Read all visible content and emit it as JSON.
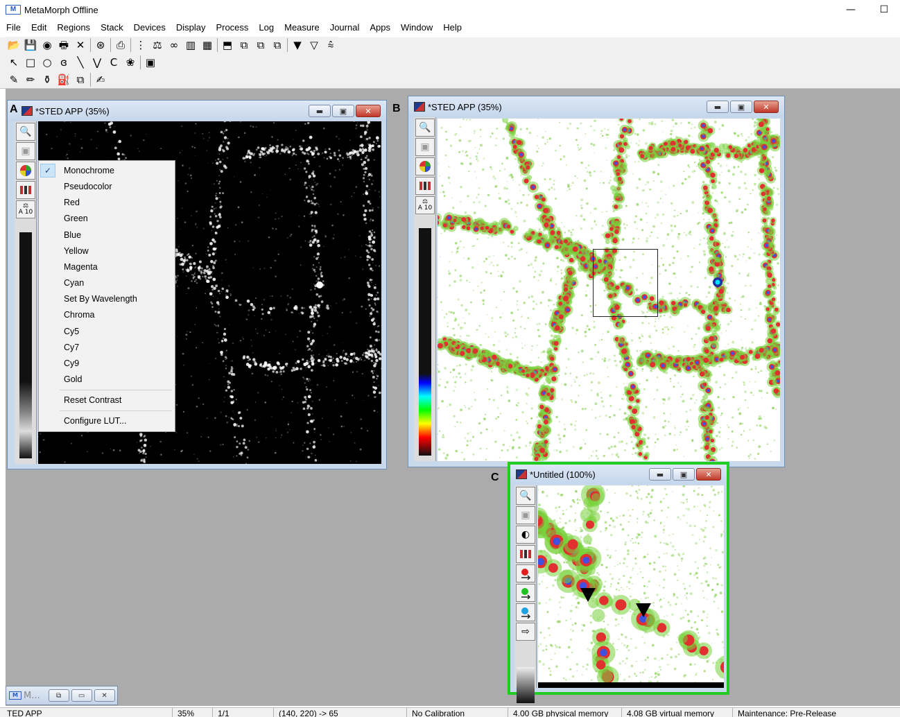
{
  "app": {
    "title": "MetaMorph Offline",
    "logo_text": "M",
    "minimize": "—",
    "maximize": "☐"
  },
  "menu": [
    "File",
    "Edit",
    "Regions",
    "Stack",
    "Devices",
    "Display",
    "Process",
    "Log",
    "Measure",
    "Journal",
    "Apps",
    "Window",
    "Help"
  ],
  "toolbar1": [
    "open-folder-icon",
    "save-icon",
    "acquire-icon",
    "print-icon",
    "close-x-icon",
    "|",
    "target-icon",
    "|",
    "camera-icon",
    "|",
    "stack-icon",
    "scale-icon",
    "binoculars-icon",
    "histogram-icon",
    "overlay-icon",
    "|",
    "f9-icon",
    "multi-1-icon",
    "multi-2-icon",
    "multi-3-icon",
    "|",
    "arrange-1-icon",
    "arrange-2-icon",
    "arrange-3-icon"
  ],
  "toolbar2": [
    "arrow-select-icon",
    "rectangle-tool-icon",
    "ellipse-tool-icon",
    "freehand-tool-icon",
    "line-tool-icon",
    "polyline-tool-icon",
    "arc-tool-icon",
    "multi-region-icon",
    "|",
    "region-color-icon"
  ],
  "toolbar3": [
    "pencil-icon",
    "pencil-yellow-icon",
    "dropper-icon",
    "fill-icon",
    "copy-region-icon",
    "|",
    "annotate-icon"
  ],
  "panels": {
    "a_label": "A",
    "b_label": "B",
    "c_label": "C"
  },
  "windows": {
    "a": {
      "title": "*STED APP (35%)"
    },
    "b": {
      "title": "*STED APP (35%)"
    },
    "c": {
      "title": "*Untitled (100%)"
    }
  },
  "sidebar": {
    "a10_top": "⚖",
    "a10_bottom": "A 10"
  },
  "context_menu": {
    "items": [
      {
        "label": "Monochrome",
        "checked": true
      },
      {
        "label": "Pseudocolor"
      },
      {
        "label": "Red"
      },
      {
        "label": "Green"
      },
      {
        "label": "Blue"
      },
      {
        "label": "Yellow"
      },
      {
        "label": "Magenta"
      },
      {
        "label": "Cyan"
      },
      {
        "label": "Set By Wavelength"
      },
      {
        "label": "Chroma"
      },
      {
        "label": "Cy5"
      },
      {
        "label": "Cy7"
      },
      {
        "label": "Cy9"
      },
      {
        "label": "Gold"
      }
    ],
    "reset_contrast": "Reset Contrast",
    "configure_lut": "Configure LUT...",
    "check": "✓"
  },
  "minimized": {
    "label": "M..."
  },
  "status": {
    "image": "TED APP",
    "zoom": "35%",
    "plane": "1/1",
    "pixel": "(140, 220) -> 65",
    "calibration": "No Calibration",
    "physical_memory": "4.00 GB physical memory",
    "virtual_memory": "4.08 GB virtual memory",
    "maintenance": "Maintenance: Pre-Release"
  },
  "colors": {
    "workspace": "#ababab",
    "highlight_border": "#22cc22",
    "window_frame": "#c9d9ec"
  }
}
